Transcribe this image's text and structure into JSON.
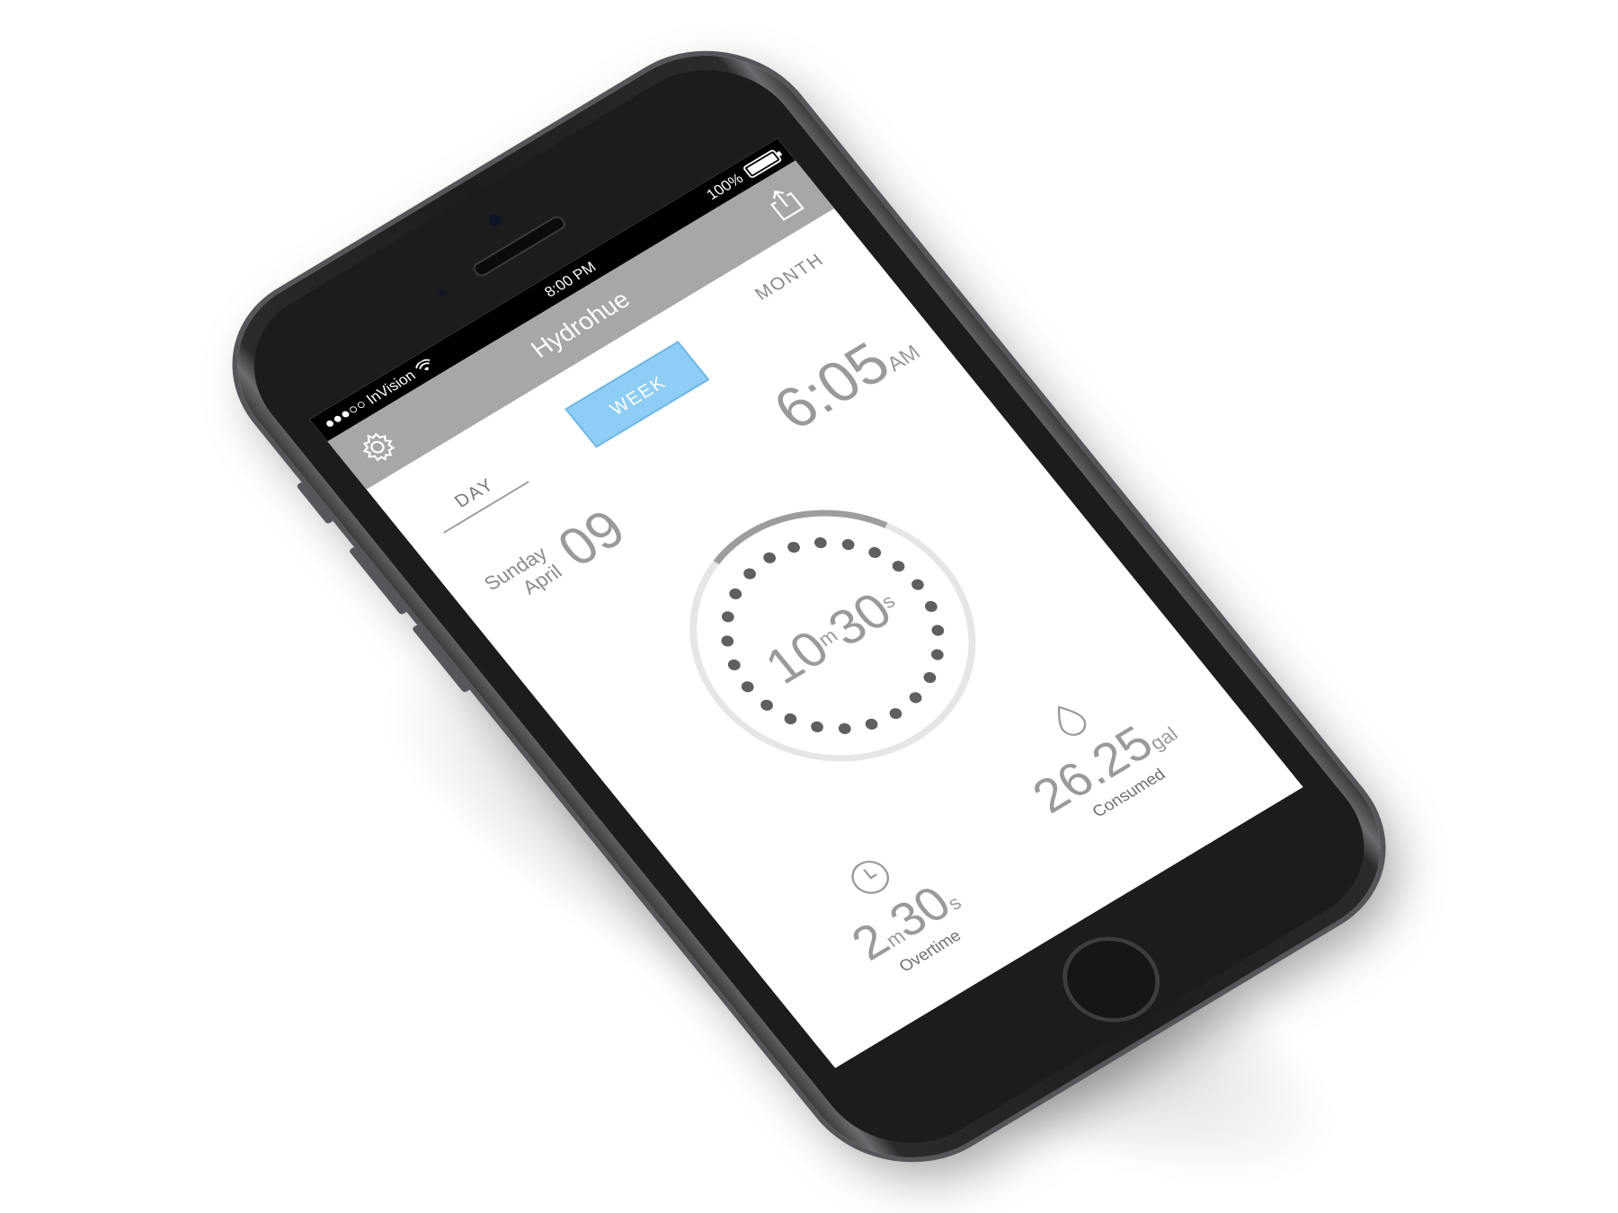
{
  "colors": {
    "accent": "#8ecdf5",
    "nav_bar": "#a7a7a7",
    "status_bar": "#000000",
    "text_muted": "#9a9a9a",
    "ring_track": "#e6e6e6",
    "ring_progress": "#9d9d9d",
    "dot": "#5f5f5f"
  },
  "status_bar": {
    "carrier": "InVision",
    "time": "8:00 PM",
    "battery": "100%",
    "battery_level": 1.0,
    "signal_icon": "signal-dots-icon",
    "wifi_icon": "wifi-icon"
  },
  "nav": {
    "title": "Hydrohue",
    "left_icon": "gear-icon",
    "right_icon": "share-icon"
  },
  "tabs": [
    {
      "label": "DAY",
      "selected": false
    },
    {
      "label": "WEEK",
      "selected": true
    },
    {
      "label": "MONTH",
      "selected": false
    }
  ],
  "date": {
    "weekday": "Sunday",
    "month": "April",
    "day": "09"
  },
  "clock": {
    "time": "6:05",
    "meridiem": "AM"
  },
  "timer": {
    "minutes": "10",
    "minutes_unit": "m",
    "seconds": "30",
    "seconds_unit": "s",
    "progress": 0.22,
    "dot_count": 24
  },
  "overtime": {
    "icon": "clock-icon",
    "minutes": "2",
    "minutes_unit": "m",
    "seconds": "30",
    "seconds_unit": "s",
    "caption": "Overtime"
  },
  "consumed": {
    "icon": "water-drop-icon",
    "value": "26.25",
    "unit": "gal",
    "caption": "Consumed"
  }
}
